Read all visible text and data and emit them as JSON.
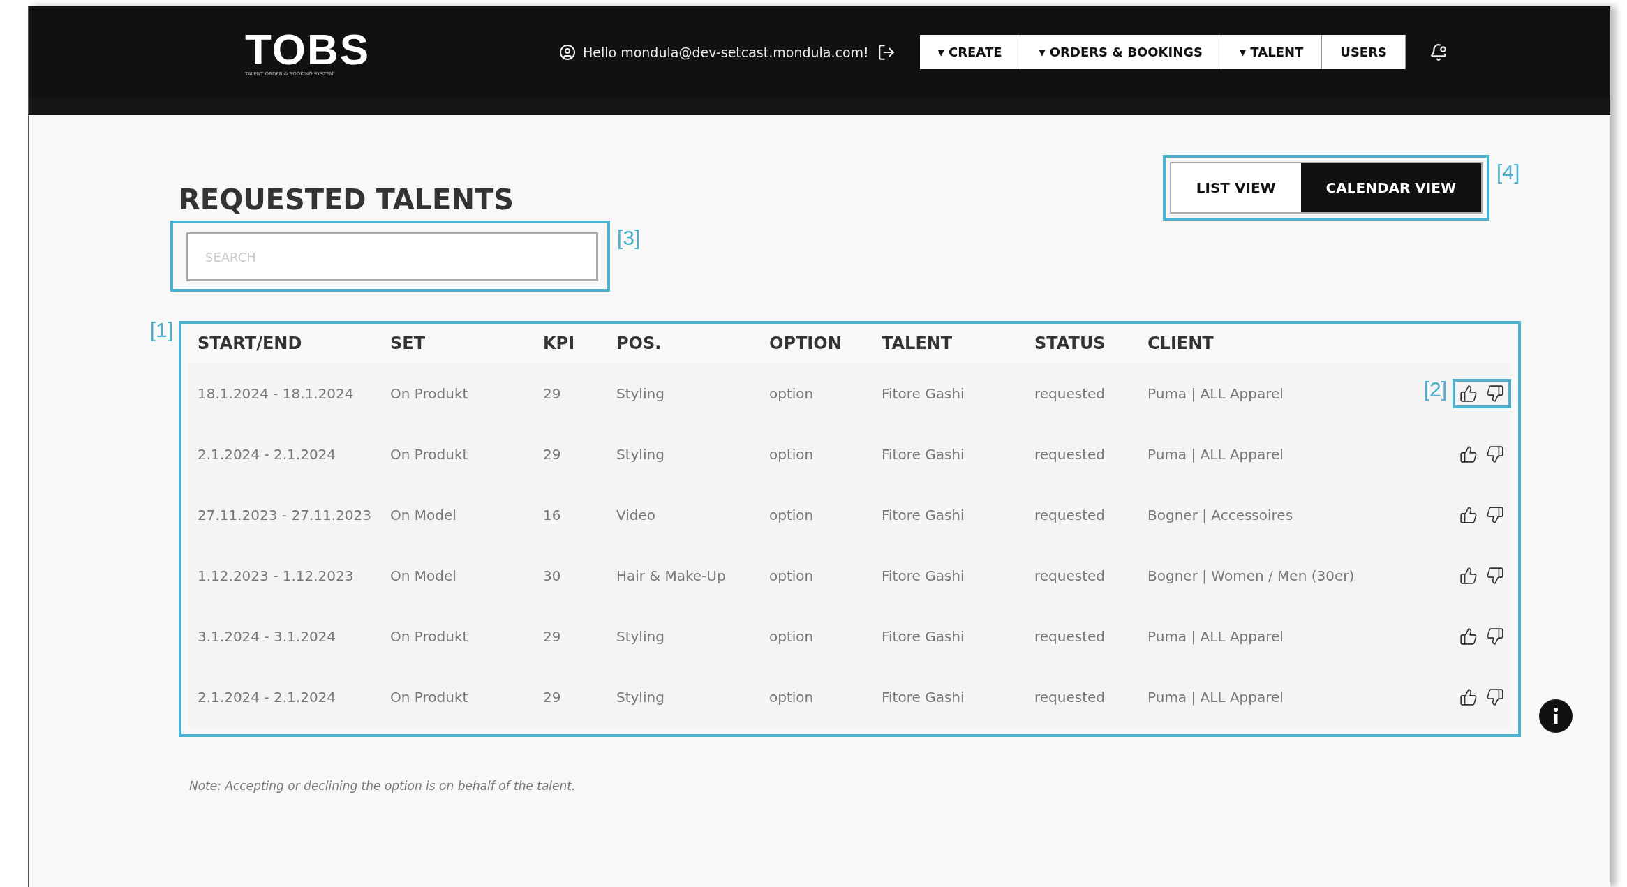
{
  "header": {
    "logo": "TOBS",
    "logo_subtitle": "TALENT ORDER & BOOKING SYSTEM",
    "greeting": "Hello mondula@dev-setcast.mondula.com!",
    "nav": [
      {
        "label": "CREATE",
        "dropdown": true
      },
      {
        "label": "ORDERS & BOOKINGS",
        "dropdown": true
      },
      {
        "label": "TALENT",
        "dropdown": true
      },
      {
        "label": "USERS",
        "dropdown": false
      }
    ],
    "caret": "▾"
  },
  "title": "REQUESTED TALENTS",
  "view_toggle": {
    "annotation": "[4]",
    "options": [
      {
        "label": "LIST VIEW",
        "selected": false
      },
      {
        "label": "CALENDAR VIEW",
        "selected": true
      }
    ]
  },
  "search": {
    "annotation": "[3]",
    "placeholder": "SEARCH"
  },
  "table": {
    "annotation": "[1]",
    "actions_annotation": "[2]",
    "columns": [
      "START/END",
      "SET",
      "KPI",
      "POS.",
      "OPTION",
      "TALENT",
      "STATUS",
      "CLIENT"
    ],
    "rows": [
      [
        "18.1.2024 - 18.1.2024",
        "On Produkt",
        "29",
        "Styling",
        "option",
        "Fitore Gashi",
        "requested",
        "Puma | ALL Apparel"
      ],
      [
        "2.1.2024 - 2.1.2024",
        "On Produkt",
        "29",
        "Styling",
        "option",
        "Fitore Gashi",
        "requested",
        "Puma | ALL Apparel"
      ],
      [
        "27.11.2023 - 27.11.2023",
        "On Model",
        "16",
        "Video",
        "option",
        "Fitore Gashi",
        "requested",
        "Bogner | Accessoires"
      ],
      [
        "1.12.2023 - 1.12.2023",
        "On Model",
        "30",
        "Hair & Make-Up",
        "option",
        "Fitore Gashi",
        "requested",
        "Bogner | Women / Men (30er)"
      ],
      [
        "3.1.2024 - 3.1.2024",
        "On Produkt",
        "29",
        "Styling",
        "option",
        "Fitore Gashi",
        "requested",
        "Puma | ALL Apparel"
      ],
      [
        "2.1.2024 - 2.1.2024",
        "On Produkt",
        "29",
        "Styling",
        "option",
        "Fitore Gashi",
        "requested",
        "Puma | ALL Apparel"
      ]
    ]
  },
  "note": "Note: Accepting or declining the option is on behalf of the talent."
}
